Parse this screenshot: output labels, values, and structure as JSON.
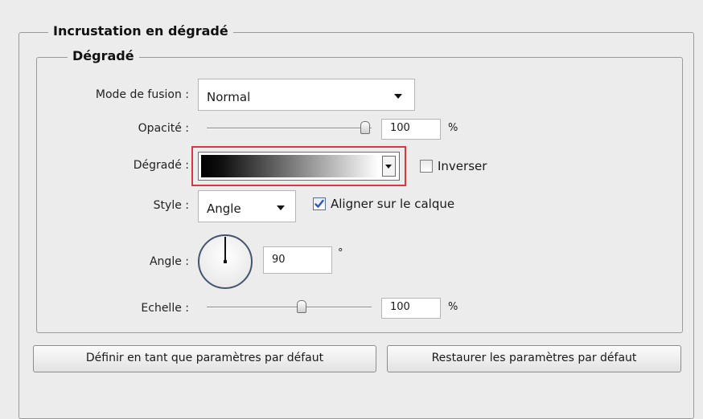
{
  "outer_group": {
    "title": "Incrustation en dégradé"
  },
  "inner_group": {
    "title": "Dégradé"
  },
  "blend_mode": {
    "label": "Mode de fusion :",
    "value": "Normal"
  },
  "opacity": {
    "label": "Opacité :",
    "value": "100",
    "unit": "%",
    "level": 1.0
  },
  "gradient": {
    "label": "Dégradé :",
    "colors": [
      "#000000",
      "#ffffff"
    ]
  },
  "reverse": {
    "label": "Inverser",
    "checked": false
  },
  "style": {
    "label": "Style :",
    "value": "Angle"
  },
  "align_layer": {
    "label": "Aligner sur le calque",
    "checked": true
  },
  "angle": {
    "label": "Angle :",
    "value": "90",
    "unit": "°"
  },
  "scale": {
    "label": "Echelle :",
    "value": "100",
    "unit": "%",
    "level": 0.59
  },
  "buttons": {
    "set_default": "Définir en tant que paramètres par défaut",
    "reset_default": "Restaurer les paramètres par défaut"
  },
  "colors": {
    "highlight": "#d9363e",
    "checkbox_blue": "#2f56b8"
  }
}
